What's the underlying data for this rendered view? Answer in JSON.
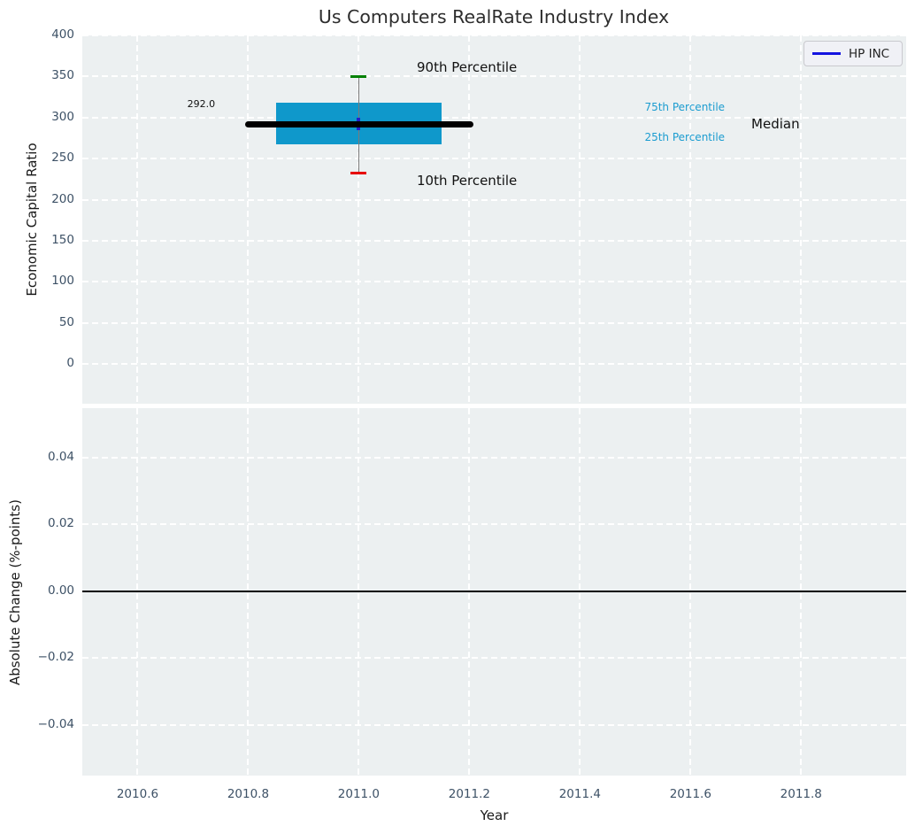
{
  "figure": {
    "title": "Us Computers RealRate Industry Index"
  },
  "legend": {
    "label": "HP INC",
    "line_color": "#1414e0",
    "position": "upper right"
  },
  "colors": {
    "plot_background": "#ecf0f1",
    "grid": "#ffffff",
    "tick_label": "#3d5166",
    "title": "#2d2d2d",
    "axis_label": "#1a1a1a",
    "box_fill": "#0f98cb",
    "percentile_text": "#1b9cd0",
    "median_line": "#000000",
    "whisker": "#7a7a7a",
    "cap_90th": "#008000",
    "cap_10th": "#e60000",
    "series_marker": "#2020cc",
    "zero_line": "#000000"
  },
  "chart_data": [
    {
      "type": "boxplot",
      "ylabel": "Economic Capital Ratio",
      "xlim": [
        2010.5,
        2011.99
      ],
      "ylim": [
        -48.5,
        400
      ],
      "yticks": [
        400,
        350,
        300,
        250,
        200,
        150,
        100,
        50,
        0
      ],
      "yticklabels": [
        "400",
        "350",
        "300",
        "250",
        "200",
        "150",
        "100",
        "50",
        "0"
      ],
      "xticks": [
        2010.6,
        2010.8,
        2011.0,
        2011.2,
        2011.4,
        2011.6,
        2011.8
      ],
      "show_xticklabels": false,
      "box": {
        "x": 2011.0,
        "p10": 232,
        "p25": 267,
        "median": 292.0,
        "p75": 318,
        "p90": 350,
        "box_x_range": [
          2010.85,
          2011.15
        ],
        "median_x_range": [
          2010.795,
          2011.207
        ],
        "cap_halfwidth": 0.0145
      },
      "series": [
        {
          "name": "HP INC",
          "points": [
            {
              "x": 2011.0,
              "y": 292.0
            }
          ]
        }
      ],
      "annotations": [
        {
          "text": "90th Percentile",
          "x": 2011.105,
          "y": 360,
          "size": 15,
          "color": "#111111",
          "anchor": "left"
        },
        {
          "text": "10th Percentile",
          "x": 2011.105,
          "y": 222,
          "size": 15,
          "color": "#111111",
          "anchor": "left"
        },
        {
          "text": "75th Percentile",
          "x": 2011.517,
          "y": 311.5,
          "size": 12,
          "color": "#1b9cd0",
          "anchor": "left"
        },
        {
          "text": "25th Percentile",
          "x": 2011.517,
          "y": 275,
          "size": 12,
          "color": "#1b9cd0",
          "anchor": "left"
        },
        {
          "text": "Median",
          "x": 2011.71,
          "y": 291,
          "size": 15,
          "color": "#111111",
          "anchor": "left"
        },
        {
          "text": "292.0",
          "x": 2010.715,
          "y": 315,
          "size": 11,
          "color": "#111111",
          "anchor": "center"
        }
      ]
    },
    {
      "type": "line",
      "ylabel": "Absolute Change (%-points)",
      "xlabel": "Year",
      "xlim": [
        2010.5,
        2011.99
      ],
      "ylim": [
        -0.0551,
        0.0548
      ],
      "yticks": [
        0.04,
        0.02,
        0,
        -0.02,
        -0.04
      ],
      "yticklabels": [
        "0.04",
        "0.02",
        "0.00",
        "−0.02",
        "−0.04"
      ],
      "xticks": [
        2010.6,
        2010.8,
        2011.0,
        2011.2,
        2011.4,
        2011.6,
        2011.8
      ],
      "xticklabels": [
        "2010.6",
        "2010.8",
        "2011.0",
        "2011.2",
        "2011.4",
        "2011.6",
        "2011.8"
      ],
      "zero_line_y": 0.0
    }
  ]
}
